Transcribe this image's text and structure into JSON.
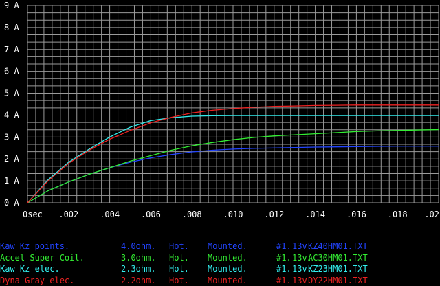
{
  "chart_data": {
    "type": "line",
    "title": "",
    "xlabel": "",
    "ylabel": "",
    "xlim": [
      0,
      0.02
    ],
    "ylim": [
      0,
      9
    ],
    "x_ticks": [
      "0sec",
      ".002",
      ".004",
      ".006",
      ".008",
      ".010",
      ".012",
      ".014",
      ".016",
      ".018",
      ".02"
    ],
    "y_ticks": [
      "0 A",
      "1 A",
      "2 A",
      "3 A",
      "4 A",
      "5 A",
      "6 A",
      "7 A",
      "8 A",
      "9 A"
    ],
    "grid": true,
    "series": [
      {
        "name": "Kaw Kz points.",
        "color": "#2244ff",
        "x": [
          0,
          0.001,
          0.002,
          0.003,
          0.004,
          0.005,
          0.006,
          0.007,
          0.008,
          0.009,
          0.01,
          0.011,
          0.012,
          0.013,
          0.014,
          0.015,
          0.016,
          0.017,
          0.018,
          0.019,
          0.02
        ],
        "values": [
          0,
          0.55,
          0.95,
          1.3,
          1.6,
          1.85,
          2.05,
          2.2,
          2.32,
          2.4,
          2.45,
          2.48,
          2.5,
          2.52,
          2.54,
          2.55,
          2.56,
          2.57,
          2.58,
          2.58,
          2.58
        ]
      },
      {
        "name": "Accel Super Coil.",
        "color": "#33ee33",
        "x": [
          0,
          0.001,
          0.002,
          0.003,
          0.004,
          0.005,
          0.006,
          0.007,
          0.008,
          0.009,
          0.01,
          0.011,
          0.012,
          0.013,
          0.014,
          0.015,
          0.016,
          0.017,
          0.018,
          0.019,
          0.02
        ],
        "values": [
          0,
          0.55,
          0.95,
          1.3,
          1.6,
          1.9,
          2.15,
          2.4,
          2.6,
          2.75,
          2.88,
          2.98,
          3.05,
          3.1,
          3.15,
          3.2,
          3.25,
          3.28,
          3.3,
          3.32,
          3.34
        ]
      },
      {
        "name": "Kaw Kz elec.",
        "color": "#33eeee",
        "x": [
          0,
          0.001,
          0.002,
          0.003,
          0.004,
          0.005,
          0.006,
          0.007,
          0.008,
          0.009,
          0.01,
          0.011,
          0.012,
          0.013,
          0.014,
          0.015,
          0.016,
          0.017,
          0.018,
          0.019,
          0.02
        ],
        "values": [
          0,
          1.05,
          1.85,
          2.45,
          3.0,
          3.45,
          3.75,
          3.88,
          3.95,
          3.97,
          3.98,
          3.98,
          3.98,
          3.98,
          3.98,
          3.98,
          3.98,
          3.98,
          3.98,
          3.98,
          3.98
        ]
      },
      {
        "name": "Dyna Gray elec.",
        "color": "#ee2222",
        "x": [
          0,
          0.001,
          0.002,
          0.003,
          0.004,
          0.005,
          0.006,
          0.007,
          0.008,
          0.009,
          0.01,
          0.011,
          0.012,
          0.013,
          0.014,
          0.015,
          0.016,
          0.017,
          0.018,
          0.019,
          0.02
        ],
        "values": [
          0,
          1.0,
          1.8,
          2.4,
          2.9,
          3.3,
          3.65,
          3.9,
          4.1,
          4.22,
          4.3,
          4.36,
          4.4,
          4.42,
          4.44,
          4.45,
          4.46,
          4.46,
          4.46,
          4.46,
          4.46
        ]
      }
    ]
  },
  "legend": [
    {
      "name": "Kaw Kz points.",
      "resistance": "4.0ohm.",
      "temp": "Hot.",
      "mount": "Mounted.",
      "num": "#1.",
      "volt": "13v.",
      "file": "KZ40HM01.TXT",
      "color": "#2244ff"
    },
    {
      "name": "Accel Super Coil.",
      "resistance": "3.0ohm.",
      "temp": "Hot.",
      "mount": "Mounted.",
      "num": "#1.",
      "volt": "13v.",
      "file": "AC30HM01.TXT",
      "color": "#33ee33"
    },
    {
      "name": "Kaw Kz elec.",
      "resistance": "2.3ohm.",
      "temp": "Hot.",
      "mount": "Mounted.",
      "num": "#1.",
      "volt": "13v.",
      "file": "KZ23HM01.TXT",
      "color": "#33eeee"
    },
    {
      "name": "Dyna Gray elec.",
      "resistance": "2.2ohm.",
      "temp": "Hot.",
      "mount": "Mounted.",
      "num": "#1.",
      "volt": "13v.",
      "file": "DY22HM01.TXT",
      "color": "#ee2222"
    }
  ]
}
